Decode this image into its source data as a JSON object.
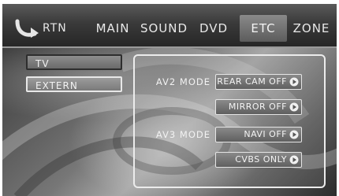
{
  "nav": {
    "back_label": "RTN",
    "back_icon": "return-arrow-icon",
    "tabs": [
      {
        "label": "MAIN"
      },
      {
        "label": "SOUND"
      },
      {
        "label": "DVD"
      },
      {
        "label": "ETC",
        "active": true
      },
      {
        "label": "ZONE"
      }
    ]
  },
  "sidebar": {
    "items": [
      {
        "label": "TV"
      },
      {
        "label": "EXTERN",
        "active": true
      }
    ]
  },
  "settings": {
    "av2": {
      "label": "AV2 MODE",
      "options": [
        {
          "label": "REAR CAM OFF"
        },
        {
          "label": "MIRROR OFF"
        }
      ]
    },
    "av3": {
      "label": "AV3 MODE",
      "options": [
        {
          "label": "NAVI OFF"
        },
        {
          "label": "CVBS ONLY"
        }
      ]
    },
    "arrow_icon": "play-arrow-icon"
  },
  "colors": {
    "active_tab": "#7a7a7a",
    "panel_border": "#ececec"
  }
}
